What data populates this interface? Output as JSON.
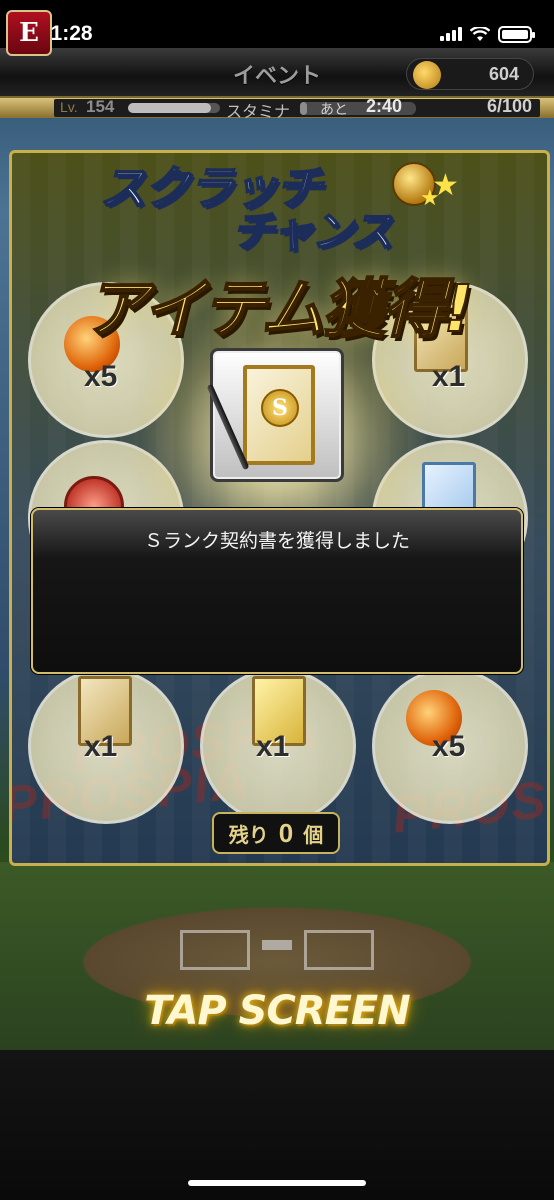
{
  "status_bar": {
    "time": "11:28"
  },
  "header": {
    "title": "イベント",
    "logo_text": "E",
    "currency": "604"
  },
  "level_bar": {
    "lv_label": "Lv.",
    "level": "154",
    "stamina_label": "スタミナ",
    "recover_label": "あと",
    "recover_time": "2:40",
    "stamina": "6/100",
    "stamina_fraction": 0.06,
    "exp_fraction": 0.9
  },
  "scratch": {
    "title_line1": "スクラッチ",
    "title_line2": "チャンス",
    "banner": "アイテム獲得!",
    "reward_emblem": "S",
    "items": [
      {
        "icon": "fireball-icon",
        "count": "x5"
      },
      {
        "icon": "contract-card-icon",
        "count": "x1"
      },
      {
        "icon": "s-coin-icon",
        "count": ""
      },
      {
        "icon": "b-contract-card-icon",
        "count": ""
      },
      {
        "icon": "s-contract-card-icon",
        "count": "x1"
      },
      {
        "icon": "gold-contract-card-icon",
        "count": "x1"
      },
      {
        "icon": "fireball-icon",
        "count": "x5"
      }
    ],
    "background_text": "PROSPIA",
    "remaining_label": "残り",
    "remaining_value": "0",
    "remaining_unit": "個"
  },
  "dialog": {
    "message": "Ｓランク契約書を獲得しました"
  },
  "footer": {
    "tap_label": "TAP SCREEN"
  }
}
